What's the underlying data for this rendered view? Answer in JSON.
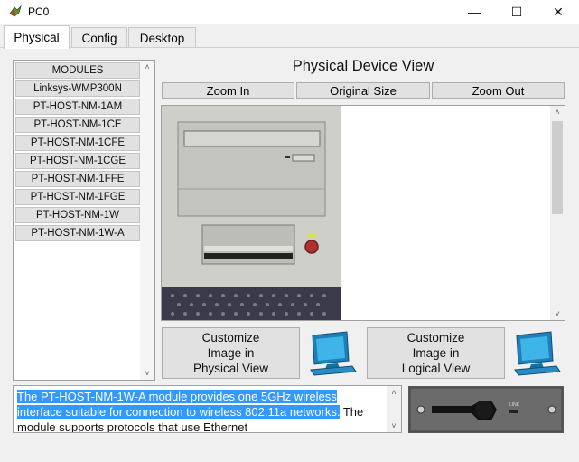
{
  "window": {
    "title": "PC0",
    "minimize_glyph": "—",
    "maximize_glyph": "☐",
    "close_glyph": "✕"
  },
  "tabs": [
    {
      "label": "Physical",
      "active": true
    },
    {
      "label": "Config",
      "active": false
    },
    {
      "label": "Desktop",
      "active": false
    }
  ],
  "modules": {
    "header": "MODULES",
    "items": [
      "Linksys-WMP300N",
      "PT-HOST-NM-1AM",
      "PT-HOST-NM-1CE",
      "PT-HOST-NM-1CFE",
      "PT-HOST-NM-1CGE",
      "PT-HOST-NM-1FFE",
      "PT-HOST-NM-1FGE",
      "PT-HOST-NM-1W",
      "PT-HOST-NM-1W-A"
    ]
  },
  "physical_view": {
    "title": "Physical Device View",
    "zoom_in": "Zoom In",
    "original_size": "Original Size",
    "zoom_out": "Zoom Out"
  },
  "customize": {
    "physical": {
      "line1": "Customize",
      "line2": "Image in",
      "line3": "Physical View"
    },
    "logical": {
      "line1": "Customize",
      "line2": "Image in",
      "line3": "Logical View"
    }
  },
  "description": {
    "selected_part": "The PT-HOST-NM-1W-A module provides one 5GHz wireless interface suitable for connection to wireless 802.11a networks.",
    "rest": " The module supports protocols that use Ethernet",
    "selection_color": "#3399ff"
  },
  "module_image": {
    "port_label": "LINK"
  },
  "icons": {
    "app": "packet-tracer-icon",
    "monitor": "computer-monitor-icon",
    "scroll_up": "▲",
    "scroll_down": "▼",
    "scroll_up_chevron": "˄",
    "scroll_down_chevron": "˅"
  }
}
